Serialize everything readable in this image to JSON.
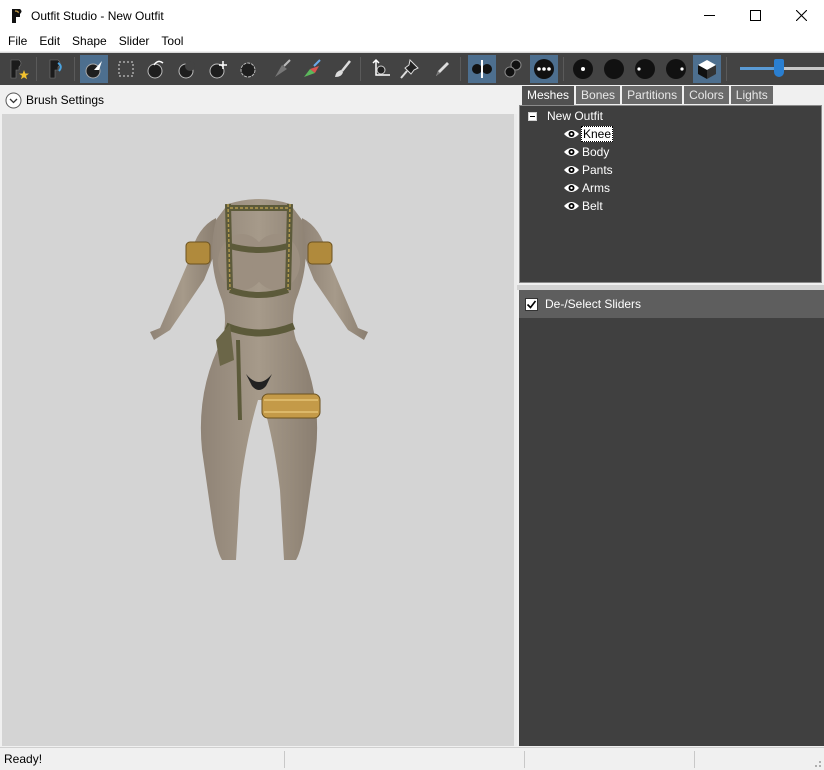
{
  "window": {
    "title": "Outfit Studio - New Outfit"
  },
  "menu": [
    "File",
    "Edit",
    "Shape",
    "Slider",
    "Tool"
  ],
  "toolbar": {
    "tools": [
      "new-project-icon",
      "load-outfit-icon",
      "select-brush-icon",
      "mask-select-icon",
      "inflate-brush-icon",
      "deflate-brush-icon",
      "move-brush-icon",
      "smooth-brush-icon",
      "mask-brush-icon",
      "weight-brush-icon",
      "color-brush-icon",
      "transform-icon",
      "pivot-pin-icon",
      "edit-pencil-icon",
      "x-mirror-icon",
      "connected-only-icon",
      "global-brush-icon",
      "vertex-dots-icon",
      "wireframe-icon",
      "lighting-icon",
      "texture-icon",
      "shading-icon"
    ],
    "zoom_slider": 0.46
  },
  "left_panel": {
    "brush_settings_label": "Brush Settings"
  },
  "right_panel": {
    "tabs": [
      "Meshes",
      "Bones",
      "Partitions",
      "Colors",
      "Lights"
    ],
    "active_tab": "Meshes",
    "tree": {
      "root_label": "New Outfit",
      "meshes": [
        "Knee",
        "Body",
        "Pants",
        "Arms",
        "Belt"
      ],
      "selected": "Knee"
    },
    "sliders_header_label": "De-/Select Sliders",
    "sliders_checked": true
  },
  "status": {
    "text": "Ready!"
  },
  "colors": {
    "toolbar_bg": "#434343",
    "active_tool": "#4d6f8f",
    "viewport_bg": "#d4d4d4",
    "panel_dark": "#404040",
    "slider_accent": "#2a7fd1"
  }
}
